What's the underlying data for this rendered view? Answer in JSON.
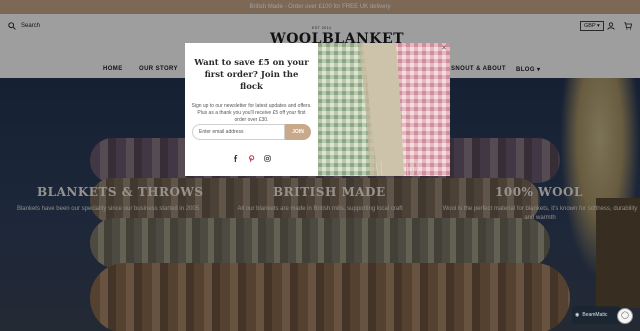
{
  "announcement": "British Made - Order over £100 for FREE UK delivery",
  "header": {
    "search_label": "Search",
    "logo_small": "EST 2014",
    "logo": "WOOLBLANKET",
    "currency": "GBP",
    "nav": [
      "HOME",
      "OUR STORY",
      "SNOUT & ABOUT",
      "BLOG"
    ]
  },
  "features": [
    {
      "title": "BLANKETS & THROWS",
      "text": "Blankets have been our speciality since our business started in 2005"
    },
    {
      "title": "BRITISH MADE",
      "text": "All our blankets are made in British mills, supporting local craft"
    },
    {
      "title": "100% WOOL",
      "text": "Wool is the perfect material for blankets, it's known for softness, durability and warmth"
    }
  ],
  "popup": {
    "title": "Want to save £5 on your first order? Join the flock",
    "description": "Sign up to our newsletter for latest updates and offers. Plus as a thank you you'll receive £5 off your first order over £30.",
    "email_placeholder": "Enter email address",
    "join_label": "JOIN",
    "close_symbol": "✕"
  },
  "widget": {
    "label": "BeamMatic"
  },
  "colors": {
    "accent": "#c8a98a",
    "hero_bg": "#2c3d5c"
  }
}
